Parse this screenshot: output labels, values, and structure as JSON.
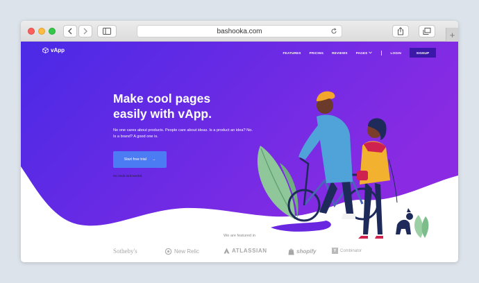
{
  "browser": {
    "url": "bashooka.com"
  },
  "site": {
    "logo": "vApp",
    "nav": {
      "features": "FEATURES",
      "pricing": "PRICING",
      "reviews": "REVIEWS",
      "pages": "PAGES",
      "login": "LOGIN",
      "signup": "SIGNUP"
    },
    "hero": {
      "headline_line1": "Make cool pages",
      "headline_line2": "easily with vApp.",
      "subtext": "No one cares about products. People care about ideas. Is a product an idea? No. Is a brand? A good one is.",
      "cta": "Start free trial",
      "cta_arrow": "→",
      "note": "No credit card needed."
    },
    "featured": {
      "label": "We are featured in",
      "brands": [
        "Sotheby's",
        "New Relic",
        "ATLASSIAN",
        "shopify",
        "Combinator"
      ],
      "yc_mark": "Y"
    }
  },
  "colors": {
    "hero_gradient_start": "#4a2ae6",
    "hero_gradient_end": "#8a2be3",
    "signup_bg": "#3c18a8",
    "cta_bg": "#4c7cf3"
  },
  "icons": {
    "back": "chevron-left-icon",
    "forward": "chevron-right-icon",
    "sidebar": "sidebar-icon",
    "reload": "reload-icon",
    "share": "share-icon",
    "tabs": "tabs-icon",
    "new_tab": "plus-icon",
    "logo": "cube-icon",
    "arrow": "arrow-right-icon"
  }
}
